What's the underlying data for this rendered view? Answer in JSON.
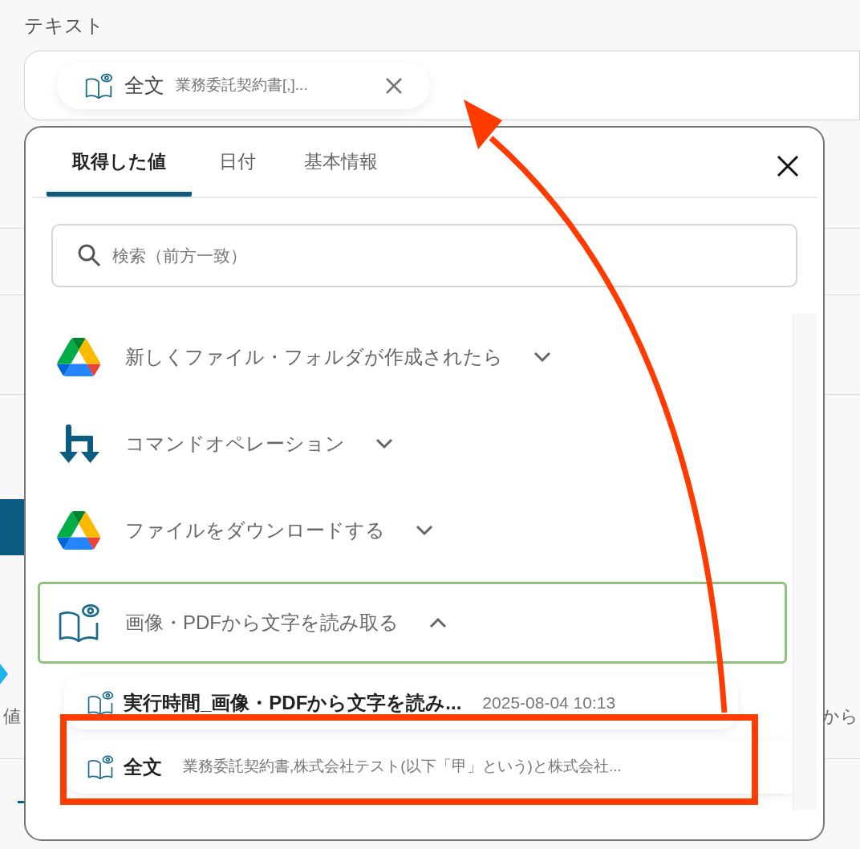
{
  "field_label": "テキスト",
  "field_chip": {
    "name": "全文",
    "value": "業務委託契約書[,]..."
  },
  "background": {
    "fragments": [
      {
        "text": "値"
      },
      {
        "text": "から"
      }
    ]
  },
  "panel": {
    "tabs": [
      {
        "label": "取得した値",
        "selected": true
      },
      {
        "label": "日付",
        "selected": false
      },
      {
        "label": "基本情報",
        "selected": false
      }
    ],
    "search": {
      "placeholder": "検索（前方一致）"
    },
    "groups": [
      {
        "kind": "drive",
        "label": "新しくファイル・フォルダが作成されたら",
        "expanded": false,
        "selected": false
      },
      {
        "kind": "command",
        "label": "コマンドオペレーション",
        "expanded": false,
        "selected": false
      },
      {
        "kind": "drive",
        "label": "ファイルをダウンロードする",
        "expanded": false,
        "selected": false
      },
      {
        "kind": "ocr",
        "label": "画像・PDFから文字を読み取る",
        "expanded": true,
        "selected": true
      }
    ],
    "outputs": [
      {
        "name": "実行時間_画像・PDFから文字を読み...",
        "value": "2025-08-04 10:13",
        "highlighted": false
      },
      {
        "name": "全文",
        "value": "業務委託契約書,株式会社テスト(以下「甲」という)と株式会社...",
        "highlighted": true
      }
    ]
  }
}
